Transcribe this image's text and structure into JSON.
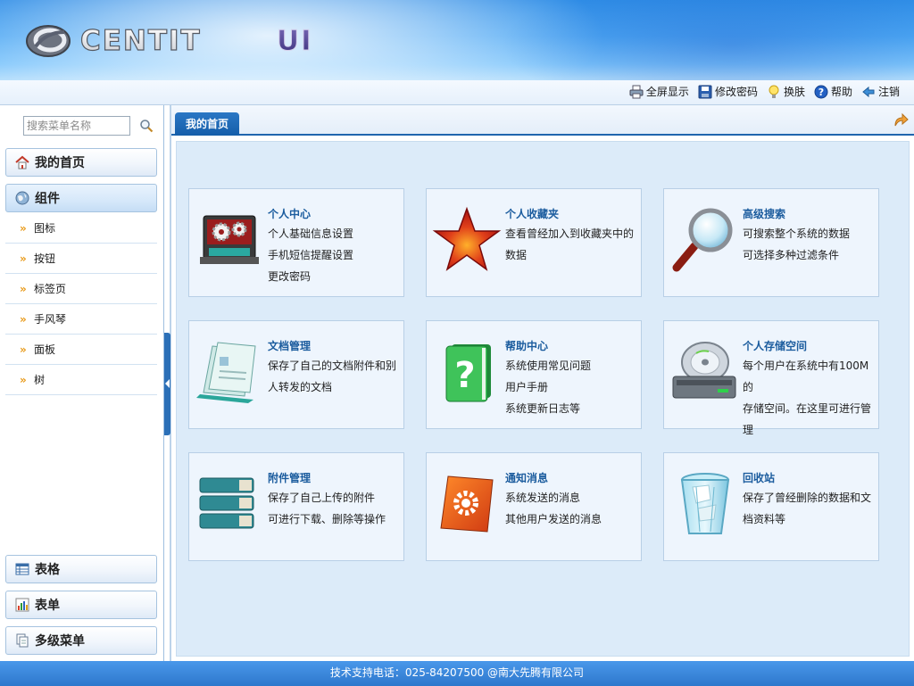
{
  "app": {
    "title": "",
    "logo_text": "CENTIT",
    "logo_suffix": "UI"
  },
  "toolbar": {
    "items": [
      {
        "label": "全屏显示",
        "icon": "printer-icon"
      },
      {
        "label": "修改密码",
        "icon": "save-icon"
      },
      {
        "label": "换肤",
        "icon": "lightbulb-icon"
      },
      {
        "label": "帮助",
        "icon": "help-icon"
      },
      {
        "label": "注销",
        "icon": "logout-icon"
      }
    ]
  },
  "sidebar": {
    "search_placeholder": "搜索菜单名称",
    "home_label": "我的首页",
    "components_label": "组件",
    "sub_items": [
      "图标",
      "按钮",
      "标签页",
      "手风琴",
      "面板",
      "树"
    ],
    "bottom_items": [
      "表格",
      "表单",
      "多级菜单"
    ]
  },
  "main": {
    "tab_label": "我的首页",
    "cards": [
      {
        "title": "个人中心",
        "lines": [
          "个人基础信息设置",
          "手机短信提醒设置",
          "更改密码"
        ],
        "icon": "settings-gears-icon"
      },
      {
        "title": "个人收藏夹",
        "lines": [
          "查看曾经加入到收藏夹中的",
          "数据"
        ],
        "icon": "star-icon"
      },
      {
        "title": "高级搜索",
        "lines": [
          "可搜索整个系统的数据",
          "可选择多种过滤条件"
        ],
        "icon": "magnifier-icon"
      },
      {
        "title": "文档管理",
        "lines": [
          "保存了自己的文档附件和别",
          "人转发的文档"
        ],
        "icon": "documents-icon"
      },
      {
        "title": "帮助中心",
        "lines": [
          "系统使用常见问题",
          "用户手册",
          "系统更新日志等"
        ],
        "icon": "help-book-icon"
      },
      {
        "title": "个人存储空间",
        "lines": [
          "每个用户在系统中有100M的",
          "存储空间。在这里可进行管",
          "理"
        ],
        "icon": "disc-drive-icon"
      },
      {
        "title": "附件管理",
        "lines": [
          "保存了自己上传的附件",
          "可进行下载、删除等操作"
        ],
        "icon": "binders-icon"
      },
      {
        "title": "通知消息",
        "lines": [
          "系统发送的消息",
          "其他用户发送的消息"
        ],
        "icon": "notice-gear-icon"
      },
      {
        "title": "回收站",
        "lines": [
          "保存了曾经删除的数据和文",
          "档资料等"
        ],
        "icon": "recycle-bin-icon"
      }
    ]
  },
  "footer": {
    "text": "技术支持电话：025-84207500 @南大先腾有限公司"
  },
  "colors": {
    "accent": "#1f65ae",
    "card_bg": "#eef5fd",
    "content_bg": "#dcebf9",
    "title_blue": "#1b5c9e"
  }
}
